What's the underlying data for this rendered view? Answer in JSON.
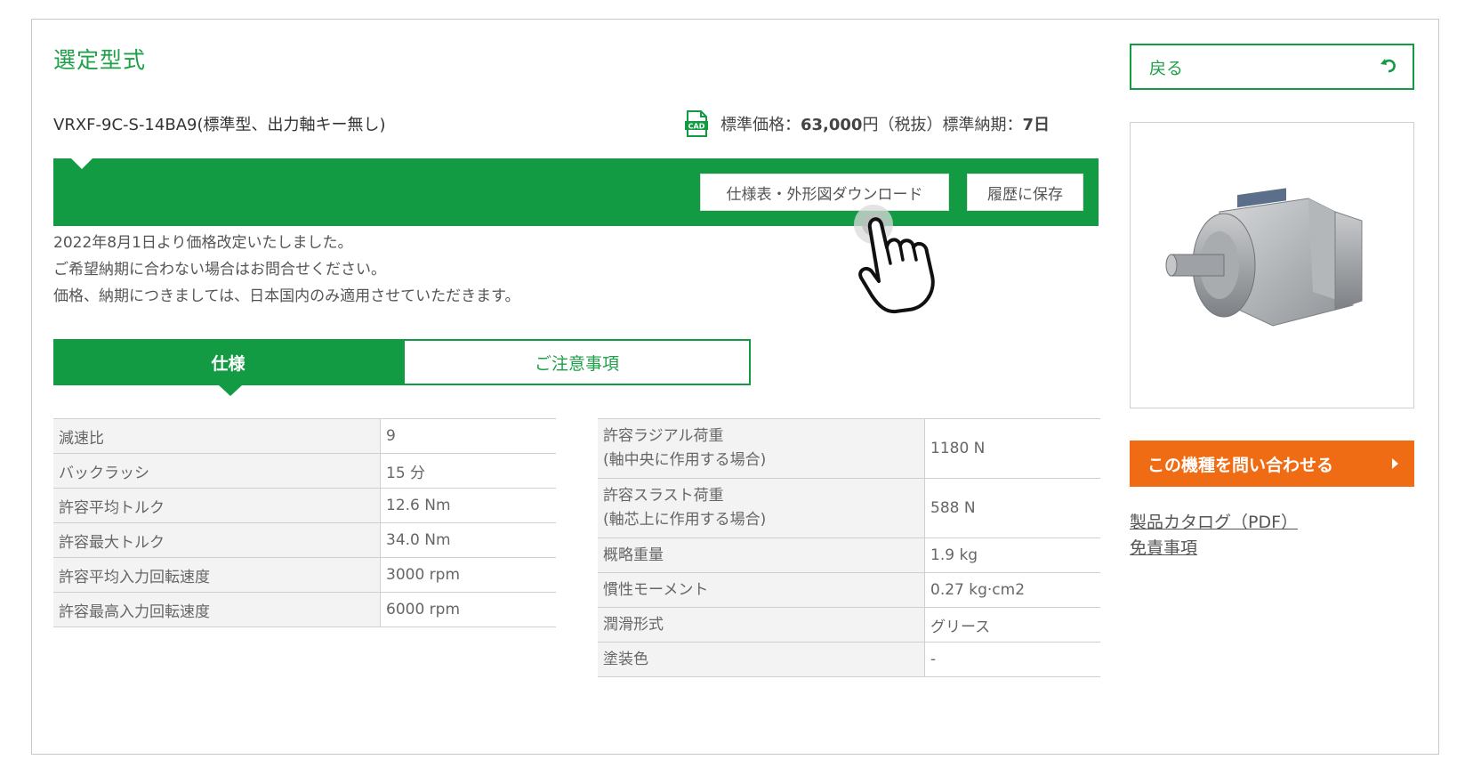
{
  "header": {
    "title": "選定型式",
    "model": "VRXF-9C-S-14BA9(標準型、出力軸キー無し)",
    "cad_icon_label": "CAD",
    "price_prefix": "標準価格：",
    "price_value": "63,000",
    "price_suffix": "円（税抜）標準納期：",
    "lead_time": "7日"
  },
  "actions": {
    "download_label": "仕様表・外形図ダウンロード",
    "save_label": "履歴に保存"
  },
  "notice": {
    "line1": "2022年8月1日より価格改定いたしました。",
    "line2": "ご希望納期に合わない場合はお問合せください。",
    "line3": "価格、納期につきましては、日本国内のみ適用させていただきます。"
  },
  "tabs": {
    "spec": "仕様",
    "notes": "ご注意事項"
  },
  "spec_left": [
    {
      "k": "減速比",
      "v": "9"
    },
    {
      "k": "バックラッシ",
      "v": "15 分"
    },
    {
      "k": "許容平均トルク",
      "v": "12.6 Nm"
    },
    {
      "k": "許容最大トルク",
      "v": "34.0 Nm"
    },
    {
      "k": "許容平均入力回転速度",
      "v": "3000 rpm"
    },
    {
      "k": "許容最高入力回転速度",
      "v": "6000 rpm"
    }
  ],
  "spec_right": [
    {
      "k1": "許容ラジアル荷重",
      "k2": "(軸中央に作用する場合)",
      "v": "1180 N"
    },
    {
      "k1": "許容スラスト荷重",
      "k2": "(軸芯上に作用する場合)",
      "v": "588 N"
    },
    {
      "k1": "概略重量",
      "v": "1.9 kg"
    },
    {
      "k1": "慣性モーメント",
      "v": "0.27 kg·cm2"
    },
    {
      "k1": "潤滑形式",
      "v": "グリース"
    },
    {
      "k1": "塗装色",
      "v": "-"
    }
  ],
  "sidebar": {
    "back_label": "戻る",
    "inquiry_label": "この機種を問い合わせる",
    "catalog_link": "製品カタログ（PDF）",
    "disclaimer_link": "免責事項"
  },
  "colors": {
    "brand_green": "#129b43",
    "accent_orange": "#ef6c14"
  },
  "icons": {
    "cad": "cad-file-icon",
    "back": "return-arrow-icon",
    "inquiry_arrow": "caret-right-icon",
    "pointer": "hand-pointer-icon"
  }
}
